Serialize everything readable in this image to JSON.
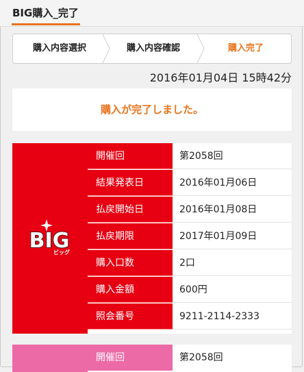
{
  "header": {
    "title": "BIG購入_完了"
  },
  "steps": [
    {
      "label": "購入内容選択"
    },
    {
      "label": "購入内容確認"
    },
    {
      "label": "購入完了"
    }
  ],
  "datetime": "2016年01月04日 15時42分",
  "complete_message": "購入が完了しました。",
  "colors": {
    "accent": "#e8731b",
    "big_red": "#e60012",
    "pink": "#ec6aa6"
  },
  "logo": {
    "text": "BIG",
    "sub": "ビッグ"
  },
  "details": [
    {
      "label": "開催回",
      "value": "第2058回"
    },
    {
      "label": "結果発表日",
      "value": "2016年01月06日"
    },
    {
      "label": "払戻開始日",
      "value": "2016年01月08日"
    },
    {
      "label": "払戻期限",
      "value": "2017年01月09日"
    },
    {
      "label": "購入口数",
      "value": "2口"
    },
    {
      "label": "購入金額",
      "value": "600円"
    },
    {
      "label": "照会番号",
      "value": "9211-2114-2333"
    }
  ],
  "second_card": {
    "label": "開催回",
    "value": "第2058回"
  }
}
